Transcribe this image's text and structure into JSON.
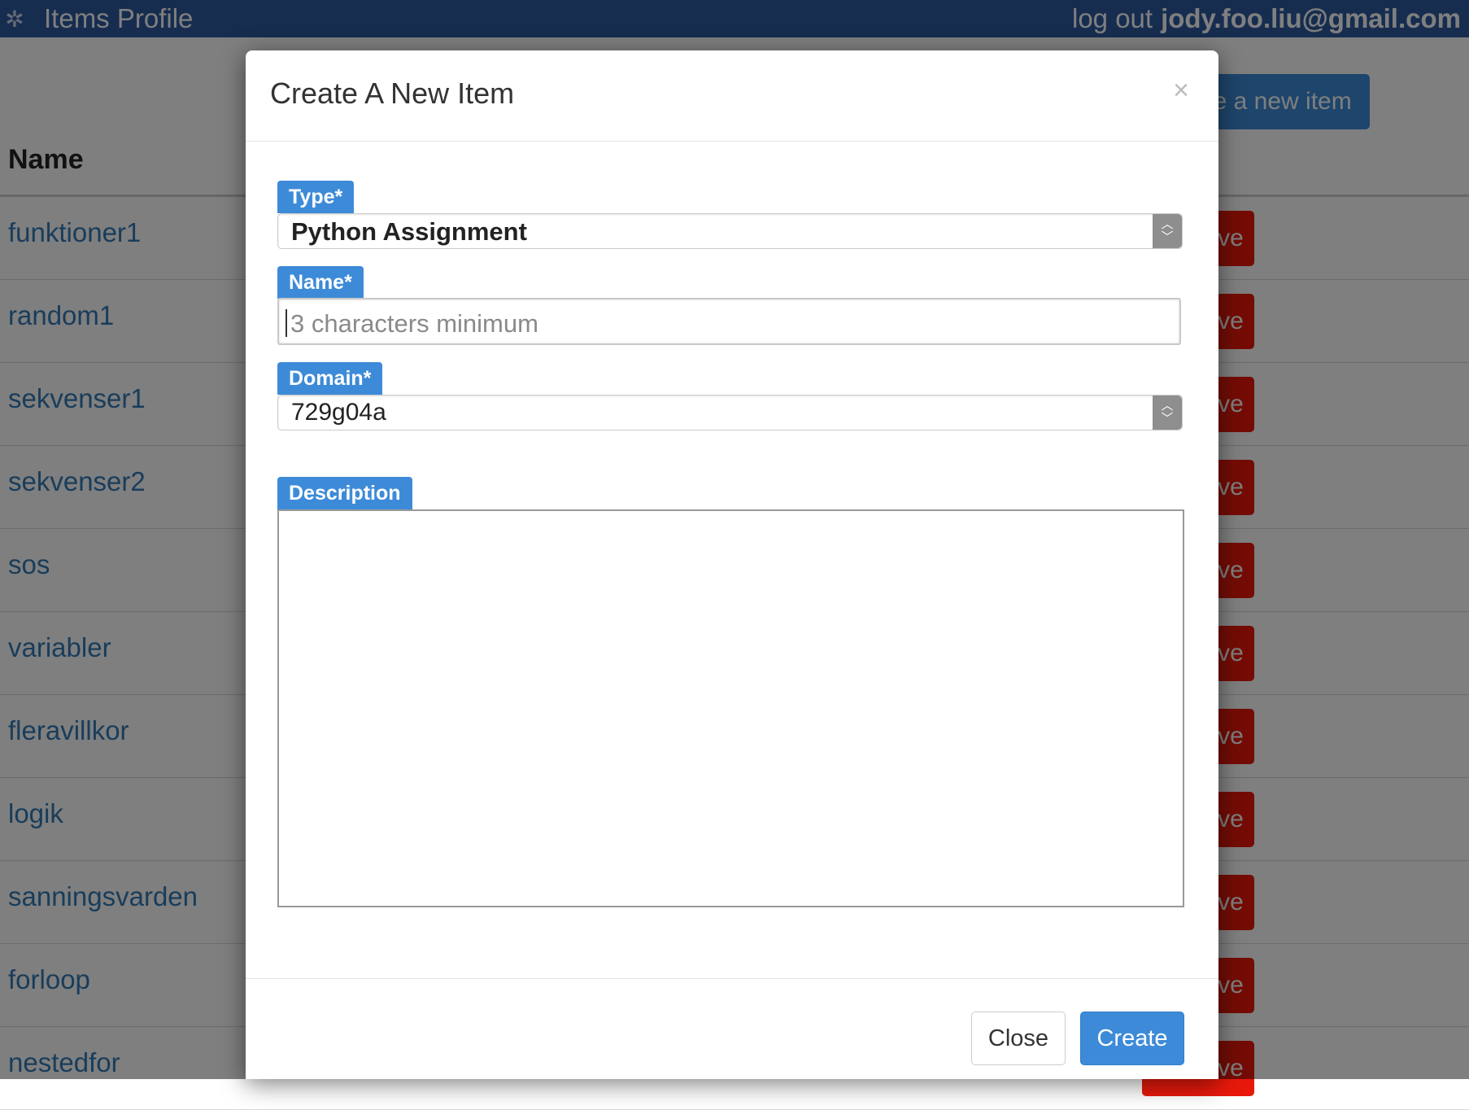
{
  "navbar": {
    "logo_icon": "app-logo-icon",
    "title": "Items Profile",
    "logout_label": "log out",
    "user_email": "jody.foo.liu@gmail.com"
  },
  "background": {
    "create_button_label": "Create a new item",
    "table_header_name": "Name",
    "remove_button_label": "Remove",
    "rows": [
      "funktioner1",
      "random1",
      "sekvenser1",
      "sekvenser2",
      "sos",
      "variabler",
      "fleravillkor",
      "logik",
      "sanningsvarden",
      "forloop",
      "nestedfor"
    ]
  },
  "modal": {
    "title": "Create A New Item",
    "close_icon": "×",
    "type": {
      "label": "Type*",
      "value": "Python Assignment"
    },
    "name": {
      "label": "Name*",
      "value": "",
      "placeholder": "3 characters minimum"
    },
    "domain": {
      "label": "Domain*",
      "value": "729g04a"
    },
    "description": {
      "label": "Description",
      "value": ""
    },
    "close_button_label": "Close",
    "create_button_label": "Create"
  },
  "colors": {
    "navbar": "#2d5aa0",
    "primary": "#3d8bd8",
    "danger": "#e8190b",
    "link": "#337ab7"
  }
}
